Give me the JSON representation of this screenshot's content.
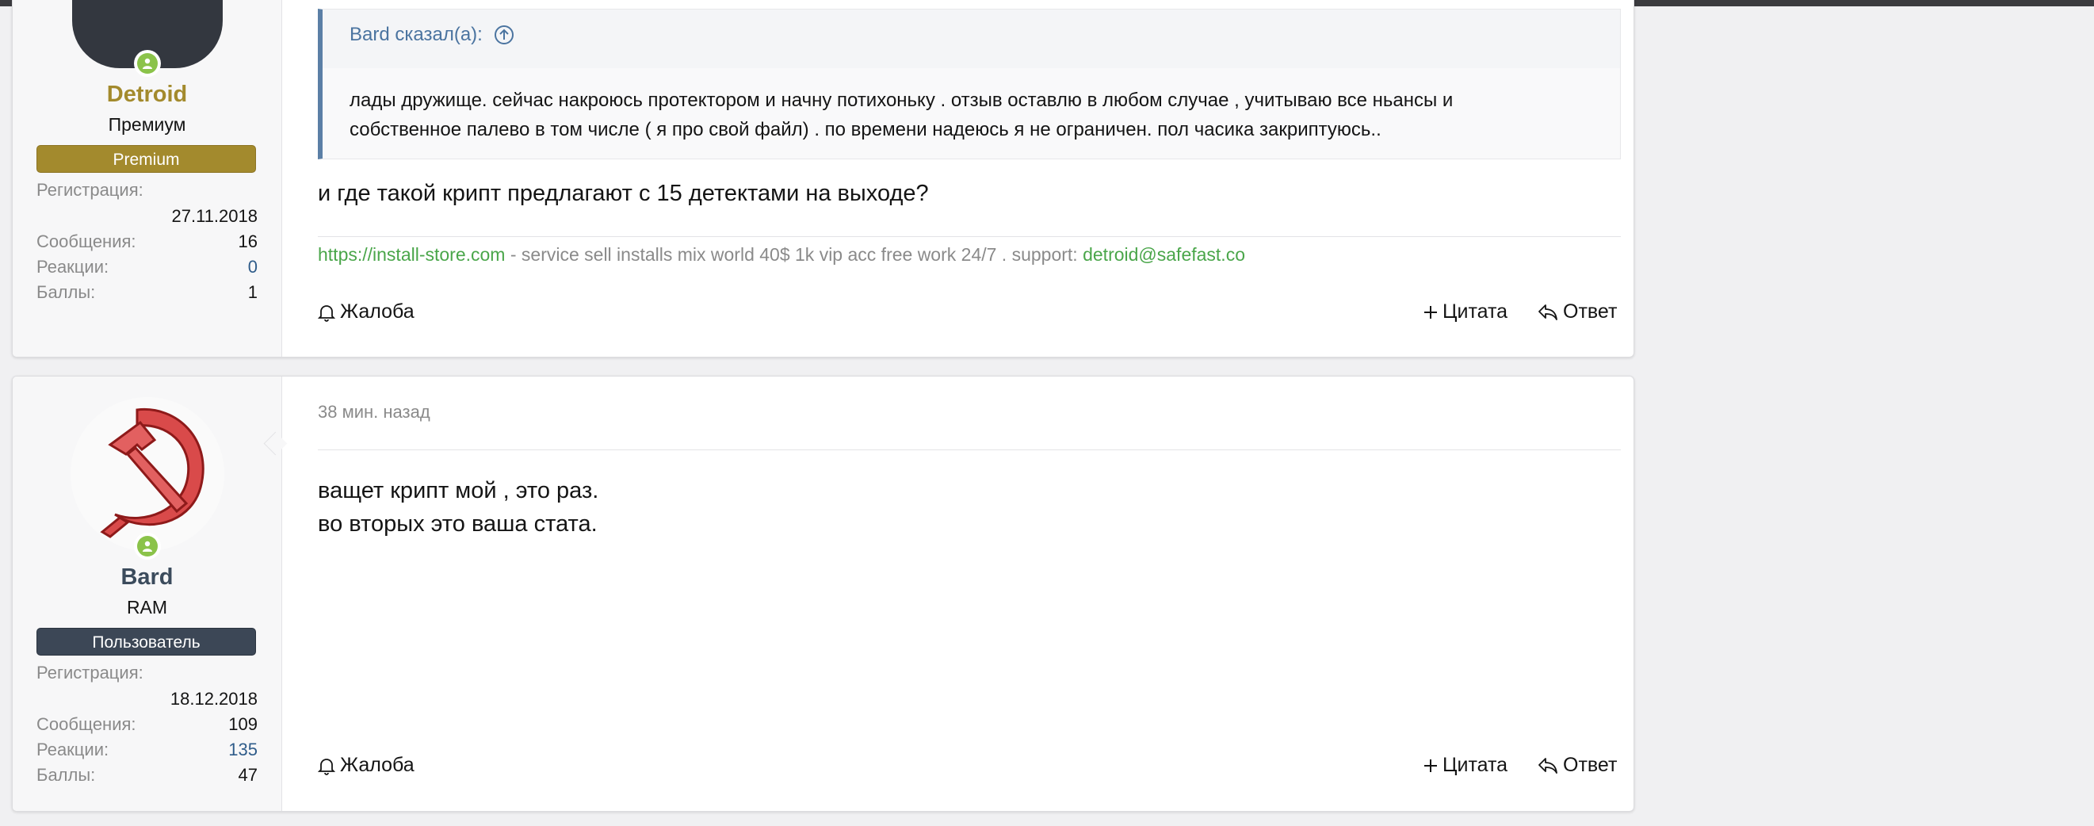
{
  "post1": {
    "user": {
      "name": "Detroid",
      "title": "Премиум",
      "banner": "Premium",
      "stats": [
        {
          "label": "Регистрация:",
          "value": "27.11.2018"
        },
        {
          "label": "Сообщения:",
          "value": "16"
        },
        {
          "label": "Реакции:",
          "value": "0"
        },
        {
          "label": "Баллы:",
          "value": "1"
        }
      ]
    },
    "quote": {
      "author": "Bard сказал(а):",
      "line1": "лады дружище. сейчас накроюсь протектором и начну потихоньку . отзыв оставлю в любом случае , учитываю все ньансы и",
      "line2": "собственное палево в том числе ( я про свой файл) . по времени надеюсь я не ограничен. пол часика закриптуюсь.."
    },
    "message": "и где такой крипт предлагают с 15 детектами на выходе?",
    "signature": {
      "link": "https://install-store.com",
      "text": " - service sell installs mix world 40$ 1k vip acc free work 24/7 . support: ",
      "email": "detroid@safefast.co"
    },
    "actions": {
      "report": "Жалоба",
      "quote": "Цитата",
      "reply": "Ответ"
    }
  },
  "post2": {
    "user": {
      "name": "Bard",
      "title": "RAM",
      "banner": "Пользователь",
      "stats": [
        {
          "label": "Регистрация:",
          "value": "18.12.2018"
        },
        {
          "label": "Сообщения:",
          "value": "109"
        },
        {
          "label": "Реакции:",
          "value": "135"
        },
        {
          "label": "Баллы:",
          "value": "47"
        }
      ]
    },
    "date": "38 мин. назад",
    "message_line1": "ващет крипт мой , это раз.",
    "message_line2": "во вторых это ваша стата.",
    "actions": {
      "report": "Жалоба",
      "quote": "Цитата",
      "reply": "Ответ"
    }
  },
  "colors": {
    "premium_name": "#a38a2d",
    "premium_banner": "#a38a2d",
    "user_name": "#3b4b5c",
    "user_banner": "#3c4756",
    "online": "#8bc34a",
    "link": "#4aa64a",
    "quote_author": "#4b74a0",
    "reactions_value": "#2f5c8a"
  }
}
